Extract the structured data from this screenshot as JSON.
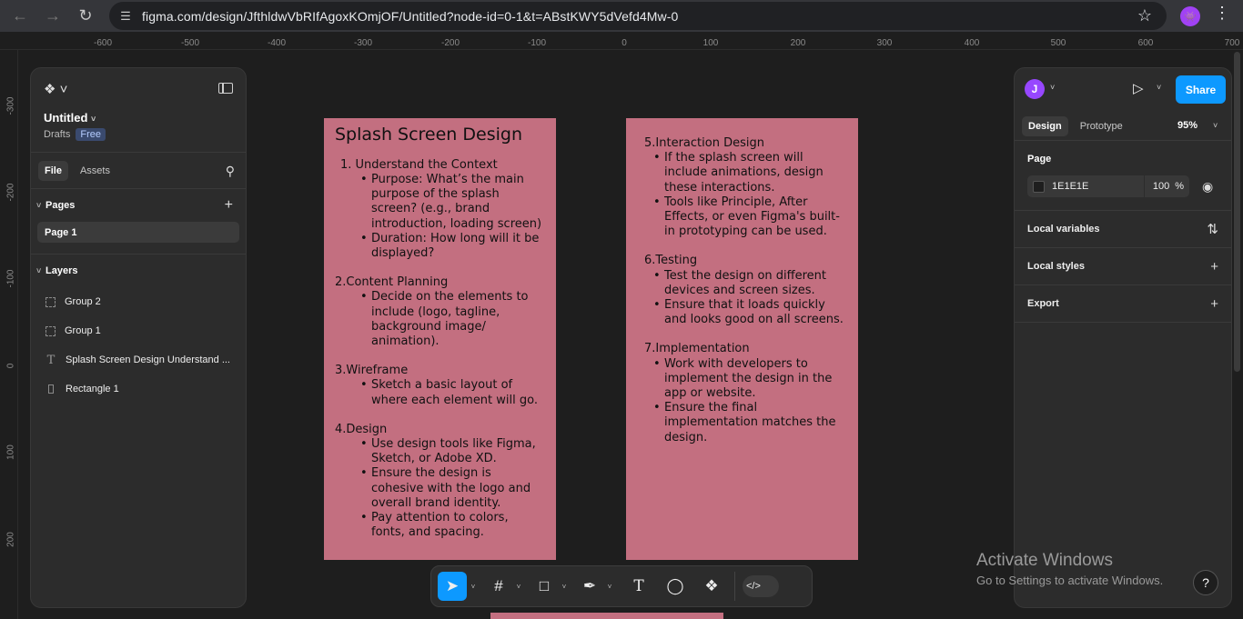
{
  "browser": {
    "url": "figma.com/design/JfthldwVbRIfAgoxKOmjOF/Untitled?node-id=0-1&t=ABstKWY5dVefd4Mw-0",
    "profile_initial": "👾"
  },
  "rulers": {
    "top": [
      "-600",
      "-500",
      "-400",
      "-300",
      "-200",
      "-100",
      "0",
      "100",
      "200",
      "300",
      "400",
      "500",
      "600",
      "700"
    ],
    "left": [
      "-300",
      "-200",
      "-100",
      "0",
      "100",
      "200"
    ]
  },
  "left_panel": {
    "file_name": "Untitled",
    "location": "Drafts",
    "plan_badge": "Free",
    "tabs": [
      "File",
      "Assets"
    ],
    "pages_label": "Pages",
    "pages": [
      "Page 1"
    ],
    "layers_label": "Layers",
    "layers": [
      {
        "name": "Group 2",
        "icon": "group-icon"
      },
      {
        "name": "Group 1",
        "icon": "group-icon"
      },
      {
        "name": "Splash Screen Design Understand ...",
        "icon": "text-icon"
      },
      {
        "name": "Rectangle 1",
        "icon": "rectangle-icon"
      }
    ]
  },
  "canvas": {
    "frame_color": "#c36f80",
    "frame1": {
      "title": "Splash Screen Design",
      "s1_head": "1. Understand the Context",
      "s1_b1": "Purpose: What’s the main purpose of the splash screen? (e.g., brand introduction, loading screen)",
      "s1_b2": "Duration: How long will it be displayed?",
      "s2_head": "2.Content Planning",
      "s2_b1": "Decide on the elements to include (logo, tagline, background image/ animation).",
      "s3_head": "3.Wireframe",
      "s3_b1": "Sketch a basic layout of where each element will go.",
      "s4_head": "4.Design",
      "s4_b1": "Use design tools like Figma, Sketch, or Adobe XD.",
      "s4_b2": "Ensure the design is cohesive with the logo and overall brand identity.",
      "s4_b3": "Pay attention to colors, fonts, and spacing."
    },
    "frame2": {
      "s5_head": "5.Interaction Design",
      "s5_b1": "If the splash screen will include animations, design these interactions.",
      "s5_b2": "Tools like Principle, After Effects, or even Figma's built-in prototyping can be used.",
      "s6_head": "6.Testing",
      "s6_b1": "Test the design on different devices and screen sizes.",
      "s6_b2": "Ensure that it loads quickly and looks good on all screens.",
      "s7_head": "7.Implementation",
      "s7_b1": "Work with developers to implement the design in the app or website.",
      "s7_b2": "Ensure the final implementation matches the design."
    }
  },
  "right_panel": {
    "avatar_initial": "J",
    "share_label": "Share",
    "tabs": [
      "Design",
      "Prototype"
    ],
    "zoom": "95%",
    "page_label": "Page",
    "fill_hex": "1E1E1E",
    "fill_opacity": "100",
    "percent": "%",
    "local_variables": "Local variables",
    "local_styles": "Local styles",
    "export": "Export"
  },
  "watermark": {
    "title": "Activate Windows",
    "subtitle": "Go to Settings to activate Windows."
  },
  "help_label": "?"
}
